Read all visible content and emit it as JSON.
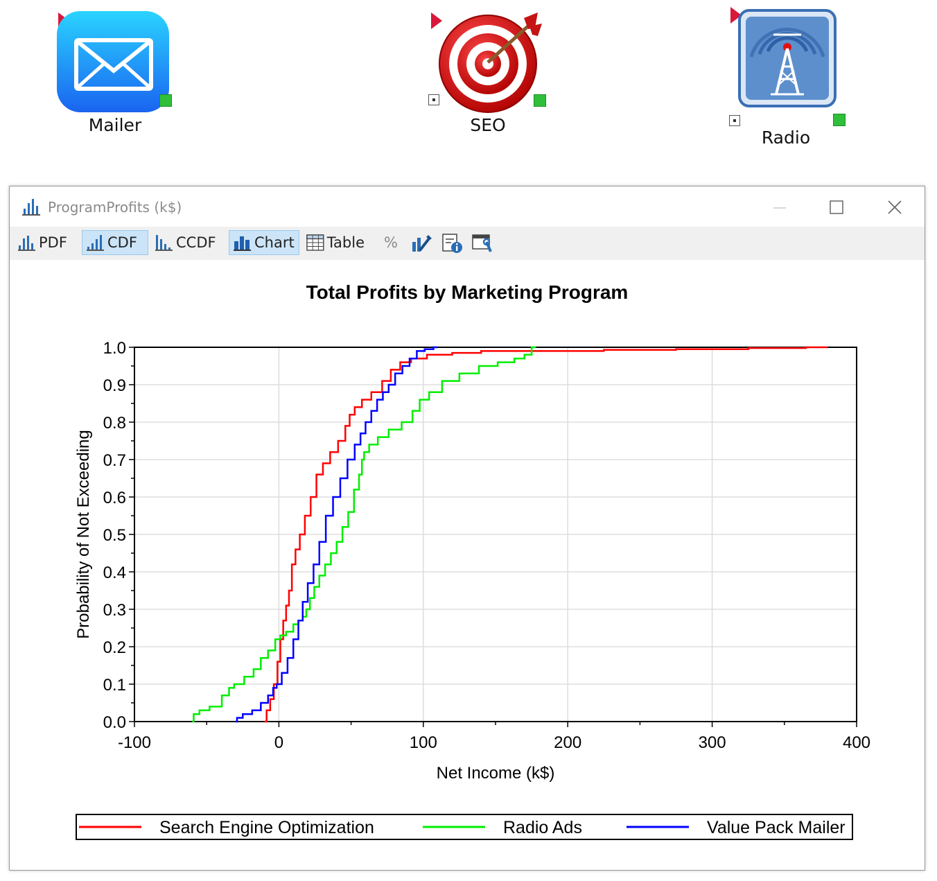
{
  "canvas": {
    "nodes": [
      {
        "label": "Mailer",
        "icon": "mail-icon"
      },
      {
        "label": "SEO",
        "icon": "target-icon"
      },
      {
        "label": "Radio",
        "icon": "radio-tower-icon"
      }
    ]
  },
  "window": {
    "title": "ProgramProfits (k$)",
    "controls": [
      "minimize",
      "maximize",
      "close"
    ]
  },
  "toolbar": {
    "pdf_label": "PDF",
    "cdf_label": "CDF",
    "ccdf_label": "CCDF",
    "chart_label": "Chart",
    "table_label": "Table",
    "percent_label": "%",
    "active_view": "CDF",
    "active_mode": "Chart"
  },
  "colors": {
    "seo": "#ff0000",
    "radio": "#00ee00",
    "mailer": "#0000ff",
    "active_button": "#cce4f7"
  },
  "chart_data": {
    "type": "line",
    "title": "Total Profits by Marketing Program",
    "xlabel": "Net Income (k$)",
    "ylabel": "Probability of Not Exceeding",
    "xlim": [
      -100,
      400
    ],
    "ylim": [
      0.0,
      1.0
    ],
    "xticks": [
      "-100",
      "0",
      "100",
      "200",
      "300",
      "400"
    ],
    "yticks": [
      "0.0",
      "0.1",
      "0.2",
      "0.3",
      "0.4",
      "0.5",
      "0.6",
      "0.7",
      "0.8",
      "0.9",
      "1.0"
    ],
    "grid": true,
    "legend_position": "bottom",
    "series": [
      {
        "name": "Search Engine Optimization",
        "color": "#ff0000",
        "x": [
          -10,
          -7,
          -5,
          -2,
          0,
          2,
          4,
          6,
          8,
          10,
          13,
          16,
          20,
          24,
          28,
          33,
          38,
          44,
          48,
          50,
          55,
          60,
          68,
          75,
          80,
          88,
          95,
          110,
          130,
          150,
          200,
          250,
          300,
          350,
          380
        ],
        "y": [
          0.0,
          0.03,
          0.06,
          0.1,
          0.16,
          0.22,
          0.27,
          0.31,
          0.35,
          0.42,
          0.46,
          0.5,
          0.55,
          0.6,
          0.66,
          0.69,
          0.72,
          0.75,
          0.79,
          0.82,
          0.84,
          0.86,
          0.88,
          0.91,
          0.94,
          0.96,
          0.97,
          0.98,
          0.985,
          0.99,
          0.99,
          0.993,
          0.995,
          0.998,
          1.0
        ]
      },
      {
        "name": "Radio Ads",
        "color": "#00ee00",
        "x": [
          -60,
          -58,
          -52,
          -44,
          -35,
          -34,
          -28,
          -20,
          -15,
          -10,
          -5,
          0,
          2,
          8,
          12,
          15,
          18,
          20,
          23,
          26,
          30,
          34,
          38,
          42,
          46,
          50,
          54,
          57,
          58,
          60,
          65,
          72,
          80,
          90,
          95,
          100,
          108,
          118,
          132,
          145,
          158,
          168,
          172,
          178
        ],
        "y": [
          0.0,
          0.02,
          0.03,
          0.04,
          0.07,
          0.09,
          0.1,
          0.12,
          0.14,
          0.17,
          0.19,
          0.22,
          0.23,
          0.24,
          0.26,
          0.27,
          0.28,
          0.3,
          0.33,
          0.36,
          0.39,
          0.42,
          0.45,
          0.48,
          0.52,
          0.56,
          0.62,
          0.66,
          0.7,
          0.72,
          0.74,
          0.76,
          0.78,
          0.8,
          0.83,
          0.86,
          0.88,
          0.91,
          0.93,
          0.95,
          0.96,
          0.97,
          0.98,
          1.0
        ]
      },
      {
        "name": "Value Pack Mailer",
        "color": "#0000ff",
        "x": [
          -30,
          -28,
          -22,
          -15,
          -10,
          -5,
          -3,
          0,
          4,
          8,
          12,
          15,
          18,
          22,
          26,
          30,
          35,
          40,
          45,
          50,
          55,
          58,
          62,
          66,
          70,
          74,
          78,
          83,
          88,
          93,
          98,
          104,
          110
        ],
        "y": [
          0.0,
          0.01,
          0.02,
          0.03,
          0.05,
          0.07,
          0.09,
          0.1,
          0.13,
          0.17,
          0.22,
          0.27,
          0.32,
          0.37,
          0.42,
          0.48,
          0.55,
          0.6,
          0.65,
          0.7,
          0.74,
          0.77,
          0.8,
          0.83,
          0.86,
          0.88,
          0.9,
          0.93,
          0.95,
          0.97,
          0.99,
          0.995,
          1.0
        ]
      }
    ]
  }
}
